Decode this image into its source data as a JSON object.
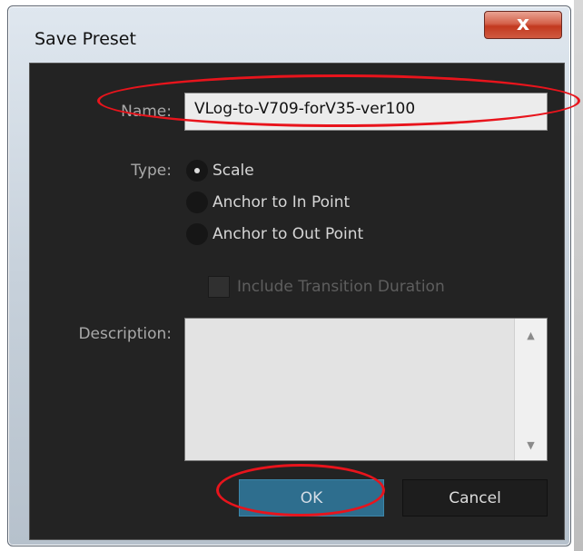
{
  "dialog": {
    "title": "Save Preset",
    "close_glyph": "x"
  },
  "form": {
    "name_label": "Name:",
    "name_value": "VLog-to-V709-forV35-ver100",
    "type_label": "Type:",
    "type_options": [
      "Scale",
      "Anchor to In Point",
      "Anchor to Out Point"
    ],
    "selected_type": "Scale",
    "include_transition_label": "Include Transition Duration",
    "include_transition_checked": false,
    "description_label": "Description:",
    "description_value": ""
  },
  "buttons": {
    "ok_label": "OK",
    "cancel_label": "Cancel"
  },
  "colors": {
    "annotation": "#e8141c",
    "ok_button": "#2e6e8e",
    "dialog_body": "#232323"
  },
  "icons": {
    "close": "close-icon",
    "scroll_up": "scroll-up-arrow-icon",
    "scroll_down": "scroll-down-arrow-icon"
  }
}
